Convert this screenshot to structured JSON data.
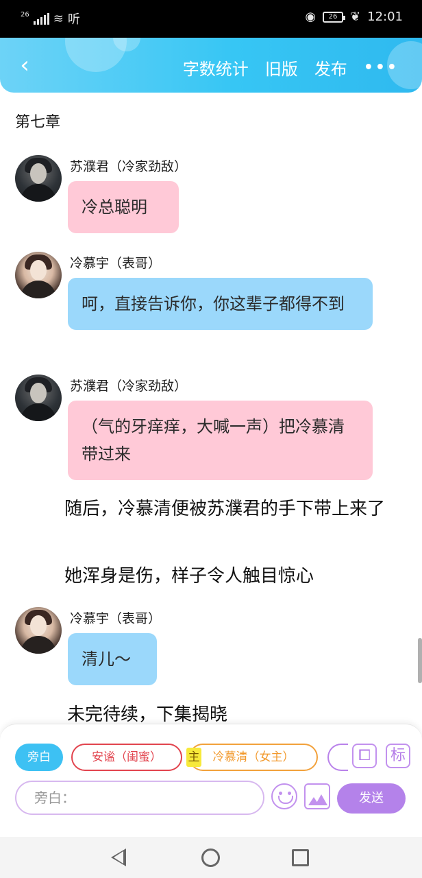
{
  "status_bar": {
    "network": "26",
    "carrier_text": "听",
    "battery": "26",
    "time": "12:01"
  },
  "header": {
    "back_icon": "chevron-left-icon",
    "links": [
      "字数统计",
      "旧版",
      "发布"
    ],
    "more_icon": "more-dots-icon",
    "more_label": "•••"
  },
  "content": {
    "chapter_title": "第七章",
    "messages": [
      {
        "speaker": "苏濮君（冷家劲敌）",
        "text": "冷总聪明",
        "bubble_color": "#ffc9d7"
      },
      {
        "speaker": "冷慕宇（表哥）",
        "text": "呵，直接告诉你，你这辈子都得不到",
        "bubble_color": "#9bd8fb"
      },
      {
        "speaker": "苏濮君（冷家劲敌）",
        "text": "（气的牙痒痒，大喊一声）把冷慕清带过来",
        "bubble_color": "#ffc9d7"
      },
      {
        "speaker": "冷慕宇（表哥）",
        "text": "清儿～",
        "bubble_color": "#9bd8fb"
      }
    ],
    "narrations": [
      "随后，冷慕清便被苏濮君的手下带上来了",
      "她浑身是伤，样子令人触目惊心",
      "未完待续，下集揭晓"
    ]
  },
  "composer": {
    "roles": [
      {
        "label": "旁白",
        "active": true
      },
      {
        "label": "安谧（闺蜜）",
        "color": "#e2444e"
      },
      {
        "label": "冷慕清（女主）",
        "tag": "主",
        "color": "#f29a2e"
      }
    ],
    "contact_icon": "contact-card-icon",
    "tag_button": "标",
    "input_placeholder": "旁白：",
    "emoji_icon": "emoji-icon",
    "image_icon": "image-icon",
    "send_label": "发送"
  },
  "colors": {
    "header_accent": "#37c6f4",
    "pink_bubble": "#ffc9d7",
    "blue_bubble": "#9bd8fb",
    "send_button": "#b482ea"
  }
}
